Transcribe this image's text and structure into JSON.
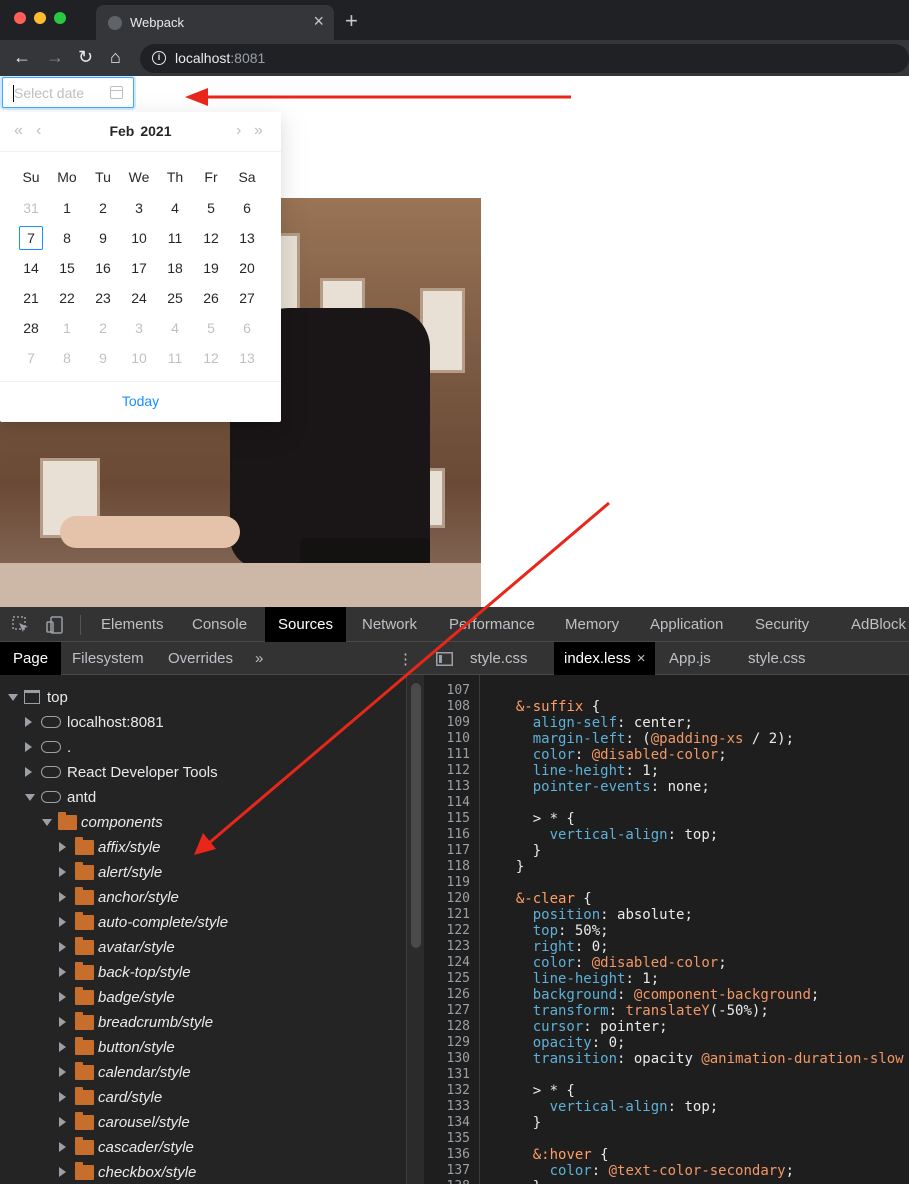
{
  "browser": {
    "tab_title": "Webpack",
    "tab_close": "×",
    "new_tab": "+",
    "url_host": "localhost",
    "url_port": ":8081",
    "nav": {
      "back": "←",
      "forward": "→",
      "reload": "↻",
      "home": "⌂"
    }
  },
  "datepicker": {
    "placeholder": "Select date",
    "month": "Feb",
    "year": "2021",
    "super_prev": "«",
    "prev": "‹",
    "next": "›",
    "super_next": "»",
    "weekdays": [
      "Su",
      "Mo",
      "Tu",
      "We",
      "Th",
      "Fr",
      "Sa"
    ],
    "weeks": [
      [
        "31",
        "1",
        "2",
        "3",
        "4",
        "5",
        "6"
      ],
      [
        "7",
        "8",
        "9",
        "10",
        "11",
        "12",
        "13"
      ],
      [
        "14",
        "15",
        "16",
        "17",
        "18",
        "19",
        "20"
      ],
      [
        "21",
        "22",
        "23",
        "24",
        "25",
        "26",
        "27"
      ],
      [
        "28",
        "1",
        "2",
        "3",
        "4",
        "5",
        "6"
      ],
      [
        "7",
        "8",
        "9",
        "10",
        "11",
        "12",
        "13"
      ]
    ],
    "today_label": "Today"
  },
  "devtools": {
    "tabs": [
      "Elements",
      "Console",
      "Sources",
      "Network",
      "Performance",
      "Memory",
      "Application",
      "Security",
      "AdBlock"
    ],
    "active_tab": "Sources",
    "navigator_tabs": [
      "Page",
      "Filesystem",
      "Overrides"
    ],
    "more": "»",
    "kebab": "⋮",
    "file_tabs": [
      "style.css",
      "index.less",
      "App.js",
      "style.css"
    ],
    "active_file": "index.less",
    "file_close": "×",
    "tree": [
      {
        "label": "top",
        "icon": "frame",
        "level": 0,
        "open": true
      },
      {
        "label": "localhost:8081",
        "icon": "cloud",
        "level": 1,
        "open": false
      },
      {
        "label": ".",
        "icon": "cloud",
        "level": 1,
        "open": false
      },
      {
        "label": "React Developer Tools",
        "icon": "cloud",
        "level": 1,
        "open": false
      },
      {
        "label": "antd",
        "icon": "cloud",
        "level": 1,
        "open": true
      },
      {
        "label": "components",
        "icon": "folder",
        "level": 2,
        "open": true
      },
      {
        "label": "affix/style",
        "icon": "folder",
        "level": 3,
        "open": false
      },
      {
        "label": "alert/style",
        "icon": "folder",
        "level": 3,
        "open": false
      },
      {
        "label": "anchor/style",
        "icon": "folder",
        "level": 3,
        "open": false
      },
      {
        "label": "auto-complete/style",
        "icon": "folder",
        "level": 3,
        "open": false
      },
      {
        "label": "avatar/style",
        "icon": "folder",
        "level": 3,
        "open": false
      },
      {
        "label": "back-top/style",
        "icon": "folder",
        "level": 3,
        "open": false
      },
      {
        "label": "badge/style",
        "icon": "folder",
        "level": 3,
        "open": false
      },
      {
        "label": "breadcrumb/style",
        "icon": "folder",
        "level": 3,
        "open": false
      },
      {
        "label": "button/style",
        "icon": "folder",
        "level": 3,
        "open": false
      },
      {
        "label": "calendar/style",
        "icon": "folder",
        "level": 3,
        "open": false
      },
      {
        "label": "card/style",
        "icon": "folder",
        "level": 3,
        "open": false
      },
      {
        "label": "carousel/style",
        "icon": "folder",
        "level": 3,
        "open": false
      },
      {
        "label": "cascader/style",
        "icon": "folder",
        "level": 3,
        "open": false
      },
      {
        "label": "checkbox/style",
        "icon": "folder",
        "level": 3,
        "open": false
      }
    ],
    "code_lines": [
      {
        "n": "107",
        "t": ""
      },
      {
        "n": "108",
        "t": "  &-suffix {"
      },
      {
        "n": "109",
        "t": "    align-self: center;"
      },
      {
        "n": "110",
        "t": "    margin-left: (@padding-xs / 2);"
      },
      {
        "n": "111",
        "t": "    color: @disabled-color;"
      },
      {
        "n": "112",
        "t": "    line-height: 1;"
      },
      {
        "n": "113",
        "t": "    pointer-events: none;"
      },
      {
        "n": "114",
        "t": ""
      },
      {
        "n": "115",
        "t": "    > * {"
      },
      {
        "n": "116",
        "t": "      vertical-align: top;"
      },
      {
        "n": "117",
        "t": "    }"
      },
      {
        "n": "118",
        "t": "  }"
      },
      {
        "n": "119",
        "t": ""
      },
      {
        "n": "120",
        "t": "  &-clear {"
      },
      {
        "n": "121",
        "t": "    position: absolute;"
      },
      {
        "n": "122",
        "t": "    top: 50%;"
      },
      {
        "n": "123",
        "t": "    right: 0;"
      },
      {
        "n": "124",
        "t": "    color: @disabled-color;"
      },
      {
        "n": "125",
        "t": "    line-height: 1;"
      },
      {
        "n": "126",
        "t": "    background: @component-background;"
      },
      {
        "n": "127",
        "t": "    transform: translateY(-50%);"
      },
      {
        "n": "128",
        "t": "    cursor: pointer;"
      },
      {
        "n": "129",
        "t": "    opacity: 0;"
      },
      {
        "n": "130",
        "t": "    transition: opacity @animation-duration-slow"
      },
      {
        "n": "131",
        "t": ""
      },
      {
        "n": "132",
        "t": "    > * {"
      },
      {
        "n": "133",
        "t": "      vertical-align: top;"
      },
      {
        "n": "134",
        "t": "    }"
      },
      {
        "n": "135",
        "t": ""
      },
      {
        "n": "136",
        "t": "    &:hover {"
      },
      {
        "n": "137",
        "t": "      color: @text-color-secondary;"
      },
      {
        "n": "138",
        "t": "    }"
      }
    ]
  },
  "colors": {
    "accent": "#1890ff",
    "arrow": "#e8261a",
    "folder": "#c76e2c"
  }
}
